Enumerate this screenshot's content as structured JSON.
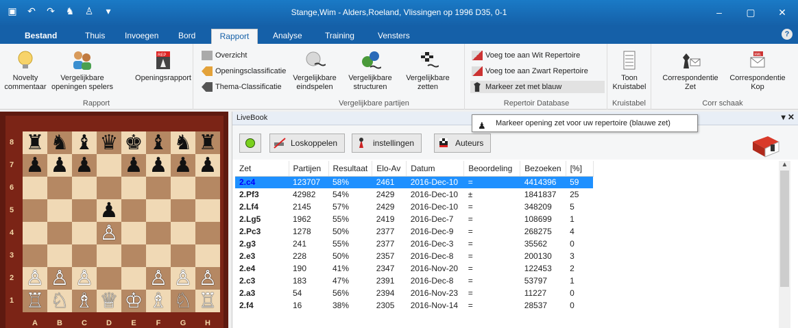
{
  "window": {
    "title": "Stange,Wim - Alders,Roeland, Vlissingen op 1996  D35, 0-1",
    "controls": [
      "–",
      "▢",
      "✕"
    ]
  },
  "tabs": [
    {
      "label": "Bestand"
    },
    {
      "label": "Thuis"
    },
    {
      "label": "Invoegen"
    },
    {
      "label": "Bord"
    },
    {
      "label": "Rapport"
    },
    {
      "label": "Analyse"
    },
    {
      "label": "Training"
    },
    {
      "label": "Vensters"
    }
  ],
  "ribbon": {
    "rapport": {
      "novelty": "Novelty\ncommentaar",
      "vergelijkbare_openingen": "Vergelijkbare\nopeningen spelers",
      "openingsrapport": "Openingsrapport",
      "overzicht": "Overzicht",
      "openingsclassificatie": "Openingsclassificatie",
      "thema": "Thema-Classificatie",
      "label": "Rapport"
    },
    "partijen": {
      "eindspelen": "Vergelijkbare\neindspelen",
      "structuren": "Vergelijkbare\nstructuren",
      "zetten": "Vergelijkbare\nzetten",
      "label": "Vergelijkbare partijen"
    },
    "repertoire": {
      "wit": "Voeg toe aan Wit Repertoire",
      "zwart": "Voeg toe aan Zwart Repertoire",
      "blauw": "Markeer zet met blauw",
      "label": "Repertoir Database"
    },
    "kruistabel": {
      "toon": "Toon\nKruistabel",
      "label": "Kruistabel"
    },
    "corr": {
      "zet": "Correspondentie\nZet",
      "kop": "Correspondentie\nKop",
      "label": "Corr schaak"
    }
  },
  "board": {
    "ranks": [
      "8",
      "7",
      "6",
      "5",
      "4",
      "3",
      "2",
      "1"
    ],
    "files": [
      "A",
      "B",
      "C",
      "D",
      "E",
      "F",
      "G",
      "H"
    ],
    "position": [
      "♜♞♝♛♚♝♞♜",
      "♟♟♟ ♟♟♟♟",
      "        ",
      "   ♟    ",
      "   ♙    ",
      "        ",
      "♙♙♙  ♙♙♙",
      "♖♘♗♕♔♗♘♖"
    ]
  },
  "livebook": {
    "title": "LiveBook",
    "controls": "▾ ✕",
    "buttons": {
      "loskoppelen": "Loskoppelen",
      "instellingen": "instellingen",
      "auteurs": "Auteurs"
    },
    "tooltip": "Markeer opening zet voor uw repertoire (blauwe zet)",
    "columns": [
      "Zet",
      "Partijen",
      "Resultaat",
      "Elo-Av",
      "Datum",
      "Beoordeling",
      "Bezoeken",
      "[%]"
    ],
    "rows": [
      [
        "2.c4",
        "123707",
        "58%",
        "2461",
        "2016-Dec-10",
        "=",
        "4414396",
        "59"
      ],
      [
        "2.Pf3",
        "42982",
        "54%",
        "2429",
        "2016-Dec-10",
        "±",
        "1841837",
        "25"
      ],
      [
        "2.Lf4",
        "2145",
        "57%",
        "2429",
        "2016-Dec-10",
        "=",
        "348209",
        "5"
      ],
      [
        "2.Lg5",
        "1962",
        "55%",
        "2419",
        "2016-Dec-7",
        "=",
        "108699",
        "1"
      ],
      [
        "2.Pc3",
        "1278",
        "50%",
        "2377",
        "2016-Dec-9",
        "=",
        "268275",
        "4"
      ],
      [
        "2.g3",
        "241",
        "55%",
        "2377",
        "2016-Dec-3",
        "=",
        "35562",
        "0"
      ],
      [
        "2.e3",
        "228",
        "50%",
        "2357",
        "2016-Dec-8",
        "=",
        "200130",
        "3"
      ],
      [
        "2.e4",
        "190",
        "41%",
        "2347",
        "2016-Nov-20",
        "=",
        "122453",
        "2"
      ],
      [
        "2.c3",
        "183",
        "47%",
        "2391",
        "2016-Dec-8",
        "=",
        "53797",
        "1"
      ],
      [
        "2.a3",
        "54",
        "56%",
        "2394",
        "2016-Nov-23",
        "=",
        "11227",
        "0"
      ],
      [
        "2.f4",
        "16",
        "38%",
        "2305",
        "2016-Nov-14",
        "=",
        "28537",
        "0"
      ]
    ],
    "selected_row": 0
  },
  "colors": {
    "accent": "#1560a8",
    "selection": "#1e90ff",
    "board_light": "#f0d9b5",
    "board_dark": "#b58863"
  }
}
